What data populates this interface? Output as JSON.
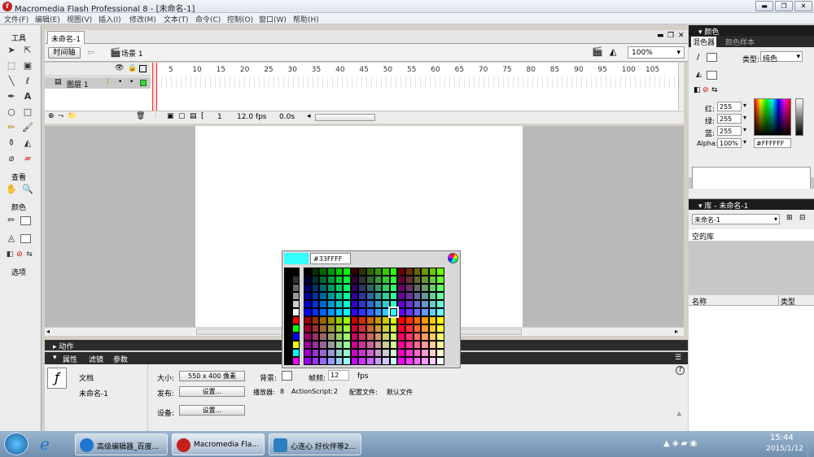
{
  "window": {
    "title": "Macromedia Flash Professional 8 - [未命名-1]",
    "app_icon": "flash-icon"
  },
  "menu": [
    "文件(F)",
    "编辑(E)",
    "视图(V)",
    "插入(I)",
    "修改(M)",
    "文本(T)",
    "命令(C)",
    "控制(O)",
    "窗口(W)",
    "帮助(H)"
  ],
  "tools": {
    "title": "工具",
    "view_label": "查看",
    "color_label": "颜色",
    "options_label": "选项"
  },
  "document": {
    "tab": "未命名-1",
    "timeline_button": "时间轴",
    "scene": "场景 1",
    "zoom": "100%"
  },
  "timeline": {
    "layer_name": "图层 1",
    "frame_numbers": [
      "5",
      "10",
      "15",
      "20",
      "25",
      "30",
      "35",
      "40",
      "45",
      "50",
      "55",
      "60",
      "65",
      "70",
      "75",
      "80",
      "85",
      "90",
      "95",
      "100",
      "105"
    ],
    "current_frame": "1",
    "fps": "12.0 fps",
    "time": "0.0s"
  },
  "actions_bar": "动作",
  "properties": {
    "tabs": [
      "属性",
      "滤镜",
      "参数"
    ],
    "doc_label": "文档",
    "doc_name": "未命名-1",
    "size_label": "大小:",
    "size_button": "550 x 400 像素",
    "bg_label": "背景:",
    "framerate_label": "帧频:",
    "framerate_value": "12",
    "fps_unit": "fps",
    "publish_label": "发布:",
    "settings_button": "设置...",
    "player_label": "播放器:",
    "player_value": "8",
    "actionscript_label": "ActionScript:",
    "actionscript_value": "2",
    "profile_label": "配置文件:",
    "profile_value": "默认文件",
    "device_label": "设备:",
    "device_button": "设置..."
  },
  "color_picker": {
    "hex": "#33FFFF",
    "selected": "#33FFFF"
  },
  "right_panel": {
    "color_title": "颜色",
    "tabs": [
      "混色器",
      "颜色样本"
    ],
    "type_label": "类型:",
    "type_value": "纯色",
    "red_label": "红:",
    "red_value": "255",
    "green_label": "绿:",
    "green_value": "255",
    "blue_label": "蓝:",
    "blue_value": "255",
    "alpha_label": "Alpha:",
    "alpha_value": "100%",
    "hex_value": "#FFFFFF",
    "library_title": "库 - 未命名-1",
    "library_select": "未命名-1",
    "library_empty": "空的库",
    "col_name": "名称",
    "col_type": "类型"
  },
  "taskbar": {
    "items": [
      "高级编辑器_百度...",
      "Macromedia Fla...",
      "心连心 好伙伴等2..."
    ],
    "time": "15:44",
    "date": "2015/1/12"
  },
  "colors": {
    "accent_selected": "#33FFFF",
    "title_dark": "#1c1c1c"
  }
}
